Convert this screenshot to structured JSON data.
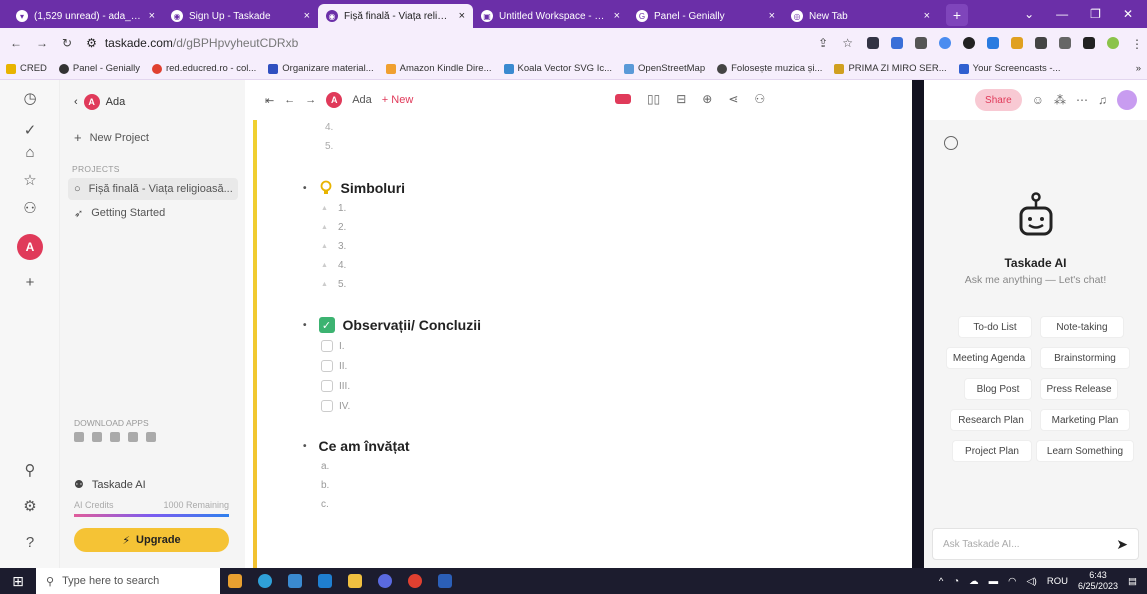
{
  "browser": {
    "tabs": [
      {
        "title": "(1,529 unread) - ada_1967",
        "active": false
      },
      {
        "title": "Sign Up - Taskade",
        "active": false
      },
      {
        "title": "Fișă finală - Viața religioasă",
        "active": true
      },
      {
        "title": "Untitled Workspace - Cre",
        "active": false
      },
      {
        "title": "Panel - Genially",
        "active": false
      },
      {
        "title": "New Tab",
        "active": false
      }
    ],
    "url_host": "taskade.com",
    "url_path": "/d/gBPHpvyheutCDRxb",
    "bookmarks": [
      "CRED",
      "Panel - Genially",
      "red.educred.ro - col...",
      "Organizare material...",
      "Amazon Kindle Dire...",
      "Koala Vector SVG Ic...",
      "OpenStreetMap",
      "Folosește muzica și...",
      "PRIMA ZI MIRO SER...",
      "Your Screencasts -..."
    ]
  },
  "sidebar": {
    "workspace": "Ada",
    "workspace_initial": "A",
    "new_project": "New Project",
    "projects_label": "PROJECTS",
    "projects": [
      "Fișă finală - Viața religioasă...",
      "Getting Started"
    ],
    "download_label": "DOWNLOAD APPS",
    "ai_name": "Taskade AI",
    "ai_credits_label": "AI Credits",
    "ai_credits_remaining": "1000 Remaining",
    "upgrade": "Upgrade",
    "rail_avatar": "A"
  },
  "main": {
    "breadcrumb": "Ada",
    "new_label": "+ New",
    "top_numbers": [
      "4.",
      "5."
    ],
    "sections": [
      {
        "title": "Simboluri",
        "items": [
          "1.",
          "2.",
          "3.",
          "4.",
          "5."
        ]
      },
      {
        "title": "Observații/ Concluzii",
        "items": [
          "I.",
          "II.",
          "III.",
          "IV."
        ]
      },
      {
        "title": "Ce am învățat",
        "items": [
          "a.",
          "b.",
          "c."
        ]
      }
    ]
  },
  "ai_panel": {
    "share": "Share",
    "title": "Taskade AI",
    "subtitle": "Ask me anything — Let's chat!",
    "suggestions": [
      "To-do List",
      "Note-taking",
      "Meeting Agenda",
      "Brainstorming",
      "Blog Post",
      "Press Release",
      "Research Plan",
      "Marketing Plan",
      "Project Plan",
      "Learn Something"
    ],
    "ask_placeholder": "Ask Taskade AI..."
  },
  "taskbar": {
    "search_placeholder": "Type here to search",
    "lang": "ROU",
    "time": "6:43",
    "date": "6/25/2023"
  },
  "colors": {
    "accent": "#e03a5a",
    "chrome": "#6b2fa8",
    "upgrade": "#f5c335",
    "check": "#3cb371"
  }
}
